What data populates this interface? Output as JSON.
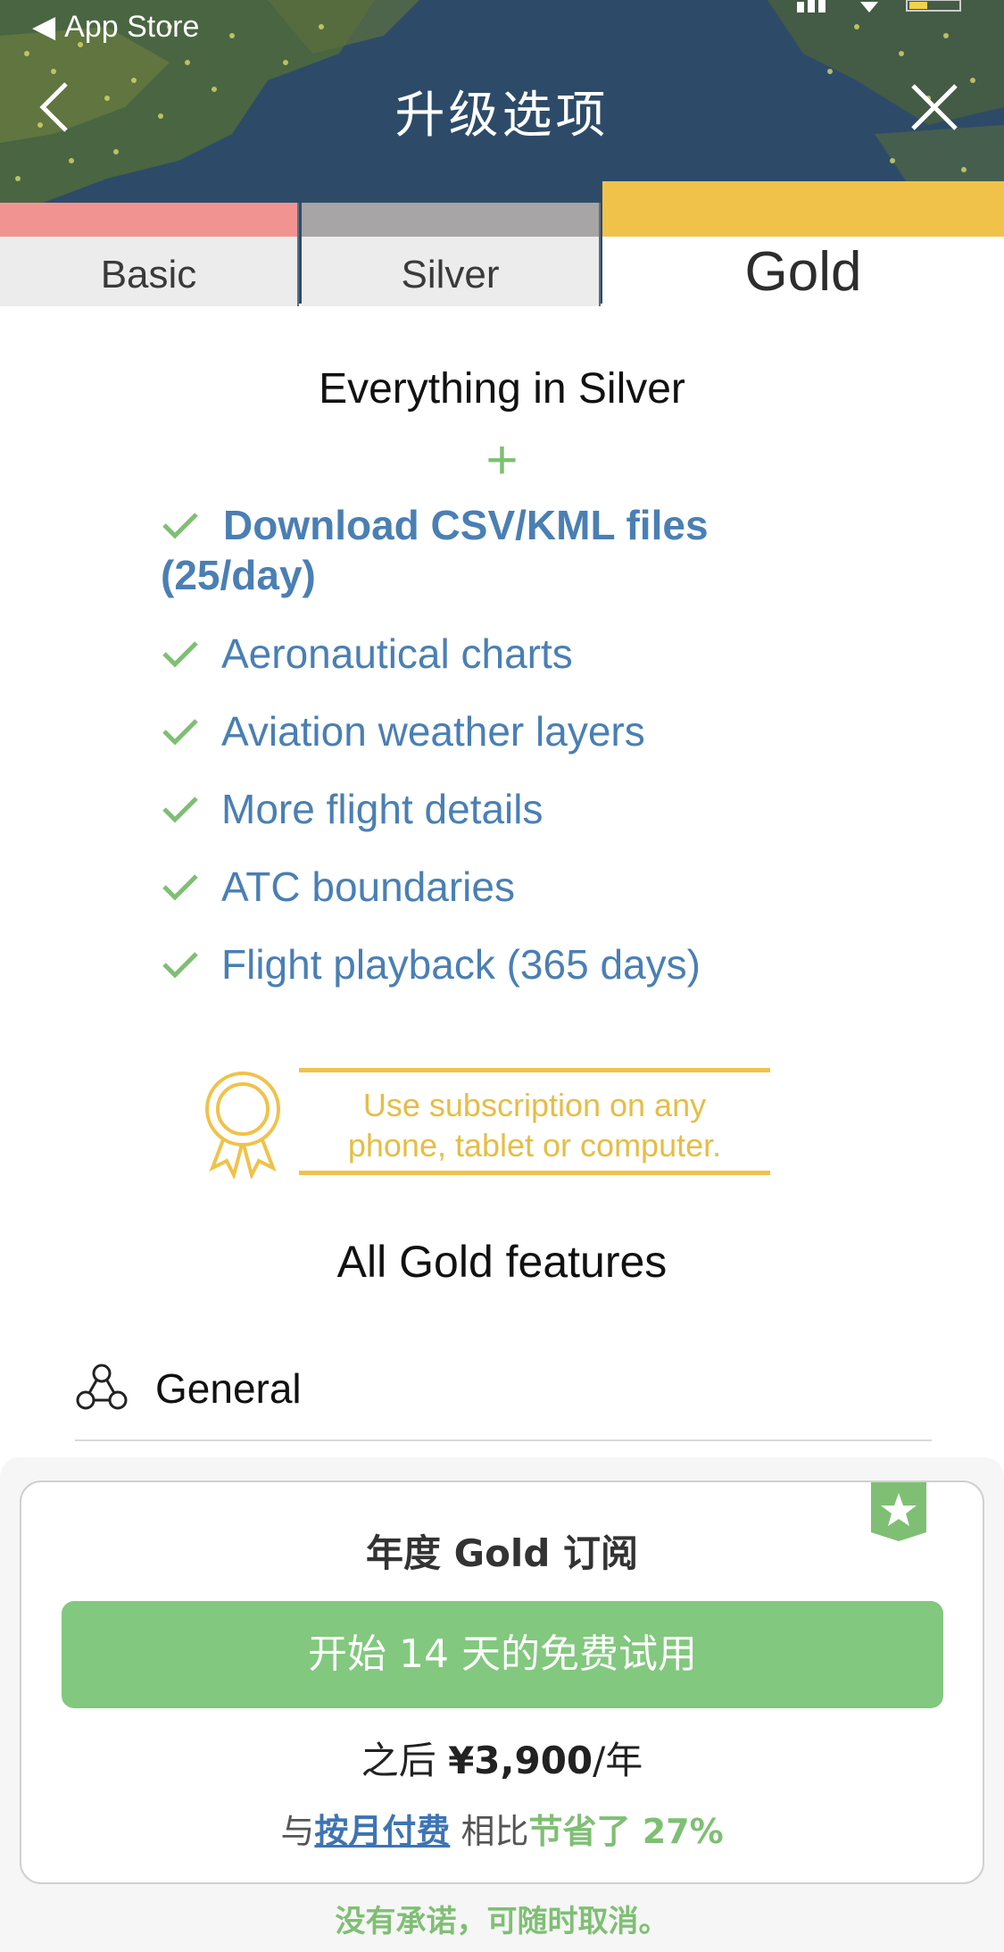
{
  "status_bar": {
    "back_label": "App Store"
  },
  "header": {
    "title": "升级选项"
  },
  "tabs": [
    {
      "label": "Basic",
      "color": "#f19491"
    },
    {
      "label": "Silver",
      "color": "#a7a5a6"
    },
    {
      "label": "Gold",
      "color": "#f0c24a",
      "selected": true
    }
  ],
  "main": {
    "everything_text": "Everything in Silver",
    "plus_symbol": "+",
    "features": [
      "Download CSV/KML files (25/day)",
      "Aeronautical charts",
      "Aviation weather layers",
      "More flight details",
      "ATC boundaries",
      "Flight playback (365 days)"
    ],
    "callout_line1": "Use subscription on any",
    "callout_line2": "phone, tablet or computer.",
    "all_features_title": "All Gold features",
    "section_general": "General"
  },
  "purchase": {
    "plan_title": "年度 Gold 订阅",
    "trial_button": "开始 14 天的免费试用",
    "price_prefix": "之后 ",
    "price_amount": "¥3,900",
    "price_suffix": "/年",
    "compare_prefix": "与",
    "compare_link": "按月付费",
    "compare_mid": "相比",
    "compare_saving": "节省了 27%",
    "cancel_note": "没有承诺，可随时取消。"
  },
  "colors": {
    "accent_green": "#82c87e",
    "gold": "#f0c24a",
    "link_blue": "#4a7fb4"
  }
}
